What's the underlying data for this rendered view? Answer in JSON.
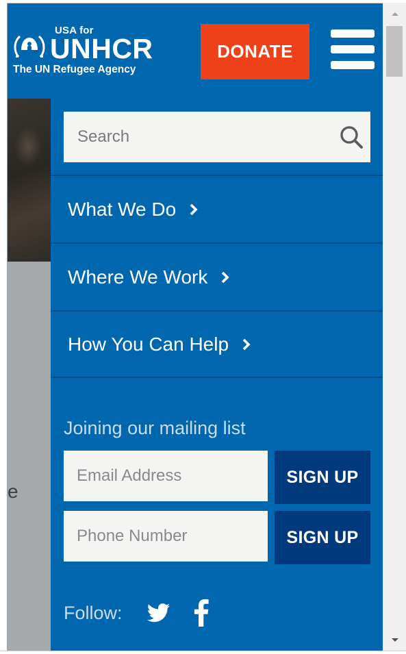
{
  "header": {
    "logo": {
      "usa_for": "USA for",
      "name": "UNHCR",
      "tagline": "The UN Refugee Agency"
    },
    "donate_label": "DONATE"
  },
  "background_page": {
    "partial_text": "e"
  },
  "menu": {
    "search": {
      "placeholder": "Search"
    },
    "nav_items": [
      {
        "label": "What We Do"
      },
      {
        "label": "Where We Work"
      },
      {
        "label": "How You Can Help"
      }
    ],
    "mailing": {
      "label": "Joining our mailing list",
      "email_placeholder": "Email Address",
      "phone_placeholder": "Phone Number",
      "signup_label": "SIGN UP"
    },
    "follow": {
      "label": "Follow:",
      "networks": [
        "twitter-icon",
        "facebook-icon"
      ]
    }
  },
  "colors": {
    "brand_blue": "#0066ad",
    "donate_orange": "#ef4119",
    "signup_navy": "#003a7c",
    "divider": "#004c8a"
  }
}
